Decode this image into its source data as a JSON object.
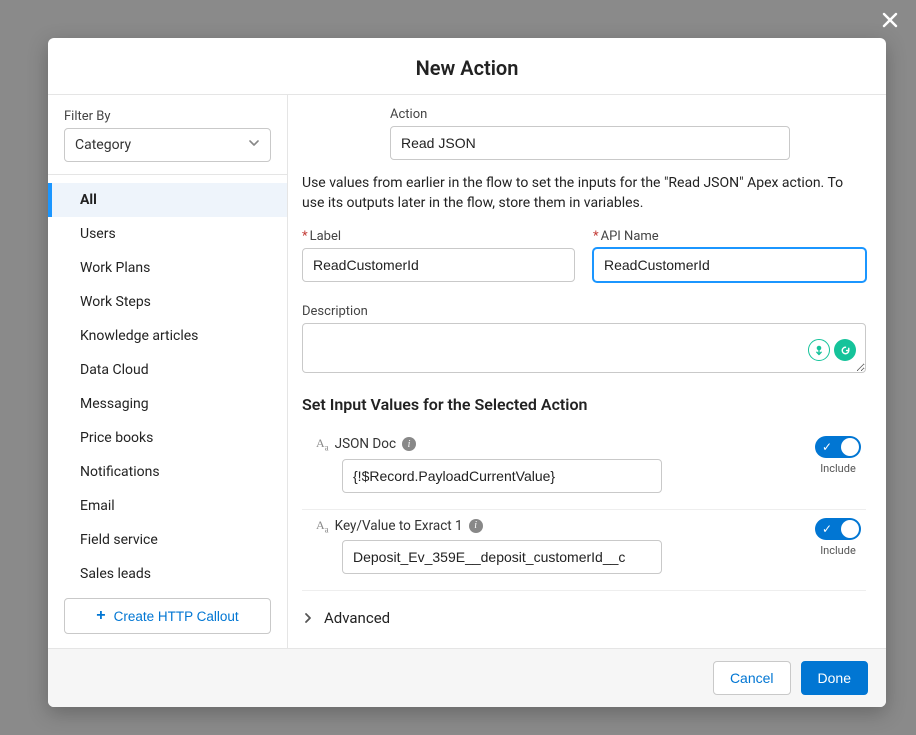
{
  "modal": {
    "title": "New Action"
  },
  "sidebar": {
    "filter_label": "Filter By",
    "filter_value": "Category",
    "items": [
      {
        "label": "All",
        "selected": true
      },
      {
        "label": "Users"
      },
      {
        "label": "Work Plans"
      },
      {
        "label": "Work Steps"
      },
      {
        "label": "Knowledge articles"
      },
      {
        "label": "Data Cloud"
      },
      {
        "label": "Messaging"
      },
      {
        "label": "Price books"
      },
      {
        "label": "Notifications"
      },
      {
        "label": "Email"
      },
      {
        "label": "Field service"
      },
      {
        "label": "Sales leads"
      }
    ],
    "create_http_label": "Create HTTP Callout"
  },
  "form": {
    "action_label": "Action",
    "action_value": "Read JSON",
    "help_text": "Use values from earlier in the flow to set the inputs for the \"Read JSON\" Apex action. To use its outputs later in the flow, store them in variables.",
    "label_label": "Label",
    "label_value": "ReadCustomerId",
    "api_name_label": "API Name",
    "api_name_value": "ReadCustomerId",
    "description_label": "Description",
    "description_value": "",
    "set_inputs_title": "Set Input Values for the Selected Action",
    "inputs": [
      {
        "name": "JSON Doc",
        "value": "{!$Record.PayloadCurrentValue}",
        "include": true,
        "include_label": "Include"
      },
      {
        "name": "Key/Value to Exract 1",
        "value": "Deposit_Ev_359E__deposit_customerId__c",
        "include": true,
        "include_label": "Include"
      }
    ],
    "advanced_label": "Advanced"
  },
  "footer": {
    "cancel": "Cancel",
    "done": "Done"
  }
}
